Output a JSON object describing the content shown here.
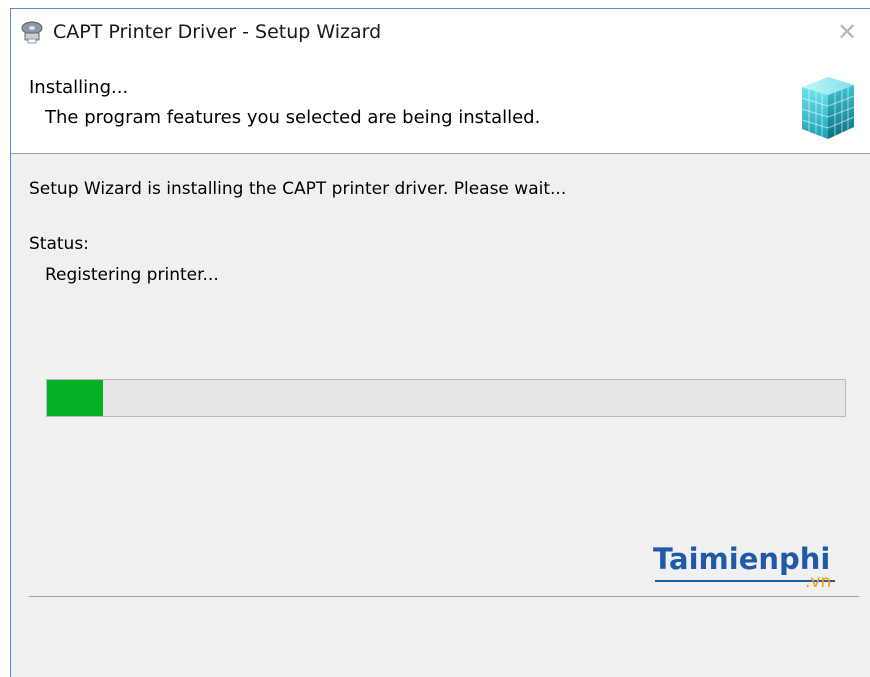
{
  "window": {
    "title": "CAPT Printer Driver - Setup Wizard",
    "close_glyph": "✕"
  },
  "header": {
    "title": "Installing...",
    "subtitle": "The program features you selected are being installed."
  },
  "main": {
    "message": "Setup Wizard is installing the CAPT printer driver. Please wait...",
    "status_label": "Status:",
    "status_value": "Registering printer...",
    "progress_fraction": 0.07
  },
  "watermark": {
    "main": "Taimienphi",
    "sub": ".vn"
  },
  "icons": {
    "app": "printer-disc-icon",
    "logo": "installer-cube-icon"
  },
  "colors": {
    "progress_fill": "#06b025",
    "window_border": "#5b8ec9",
    "watermark_blue": "#1e5aa6",
    "watermark_orange": "#f2a007"
  }
}
